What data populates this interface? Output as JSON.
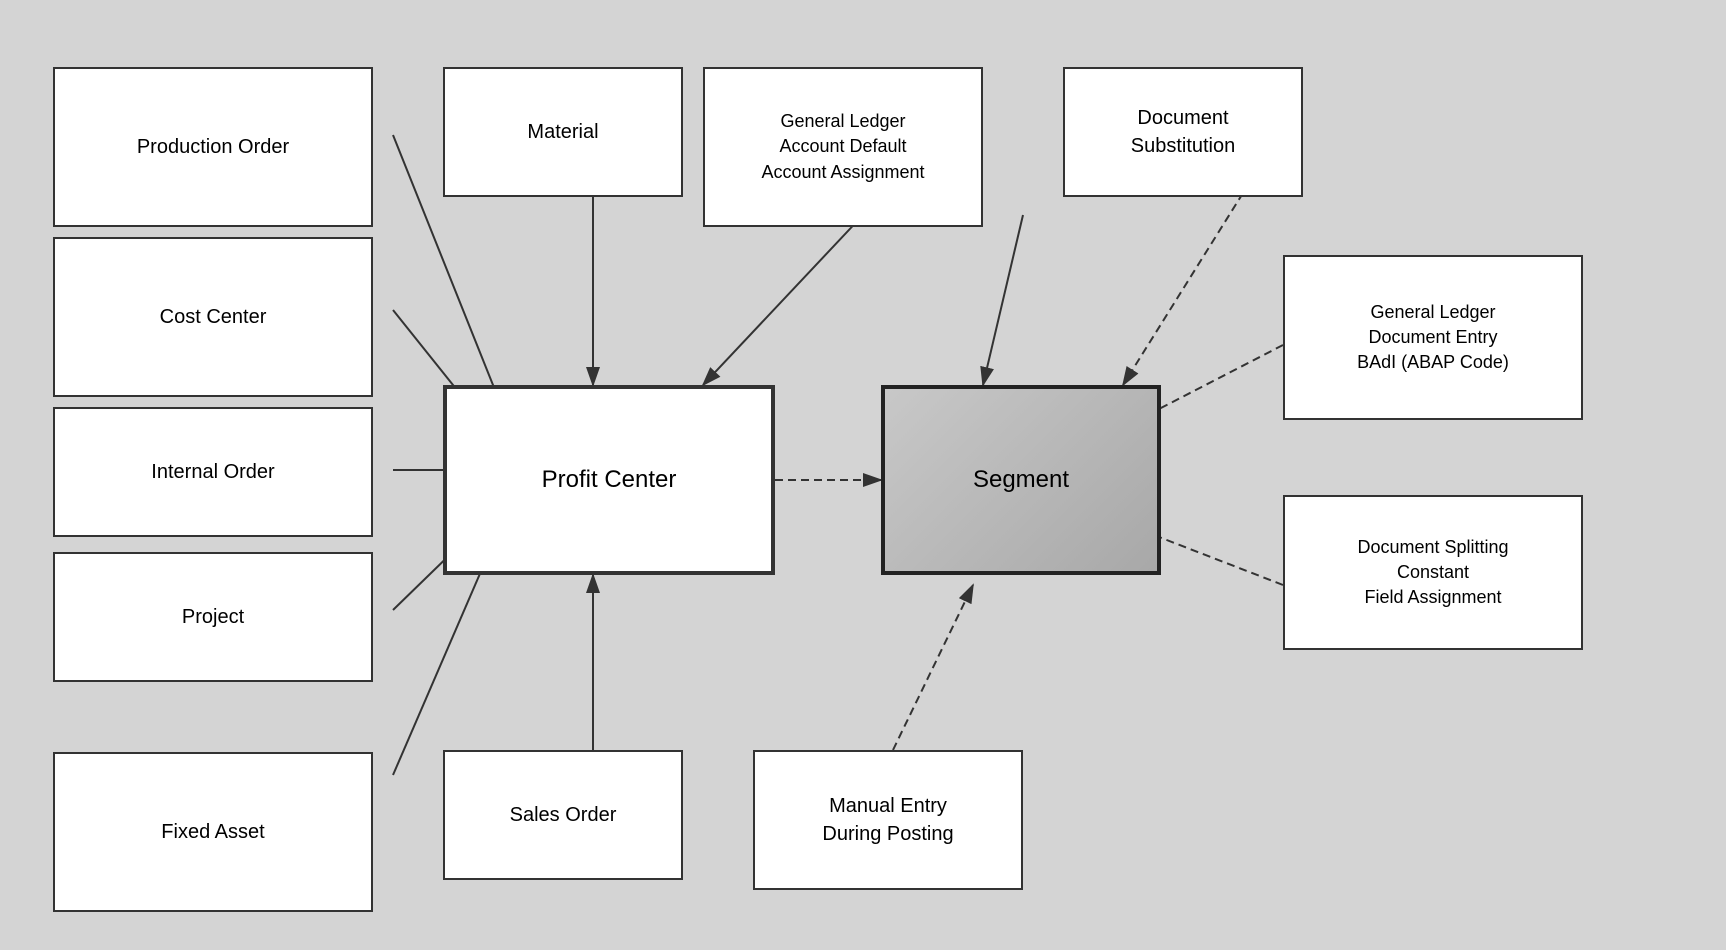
{
  "boxes": {
    "production_order": {
      "label": "Production Order"
    },
    "cost_center": {
      "label": "Cost Center"
    },
    "internal_order": {
      "label": "Internal Order"
    },
    "project": {
      "label": "Project"
    },
    "fixed_asset": {
      "label": "Fixed Asset"
    },
    "material": {
      "label": "Material"
    },
    "gl_account": {
      "label": "General Ledger\nAccount Default\nAccount Assignment"
    },
    "document_substitution": {
      "label": "Document\nSubstitution"
    },
    "profit_center": {
      "label": "Profit Center"
    },
    "segment": {
      "label": "Segment"
    },
    "sales_order": {
      "label": "Sales Order"
    },
    "manual_entry": {
      "label": "Manual Entry\nDuring Posting"
    },
    "gl_badi": {
      "label": "General Ledger\nDocument Entry\nBAdI (ABAP Code)"
    },
    "doc_splitting": {
      "label": "Document Splitting\nConstant\nField Assignment"
    }
  }
}
